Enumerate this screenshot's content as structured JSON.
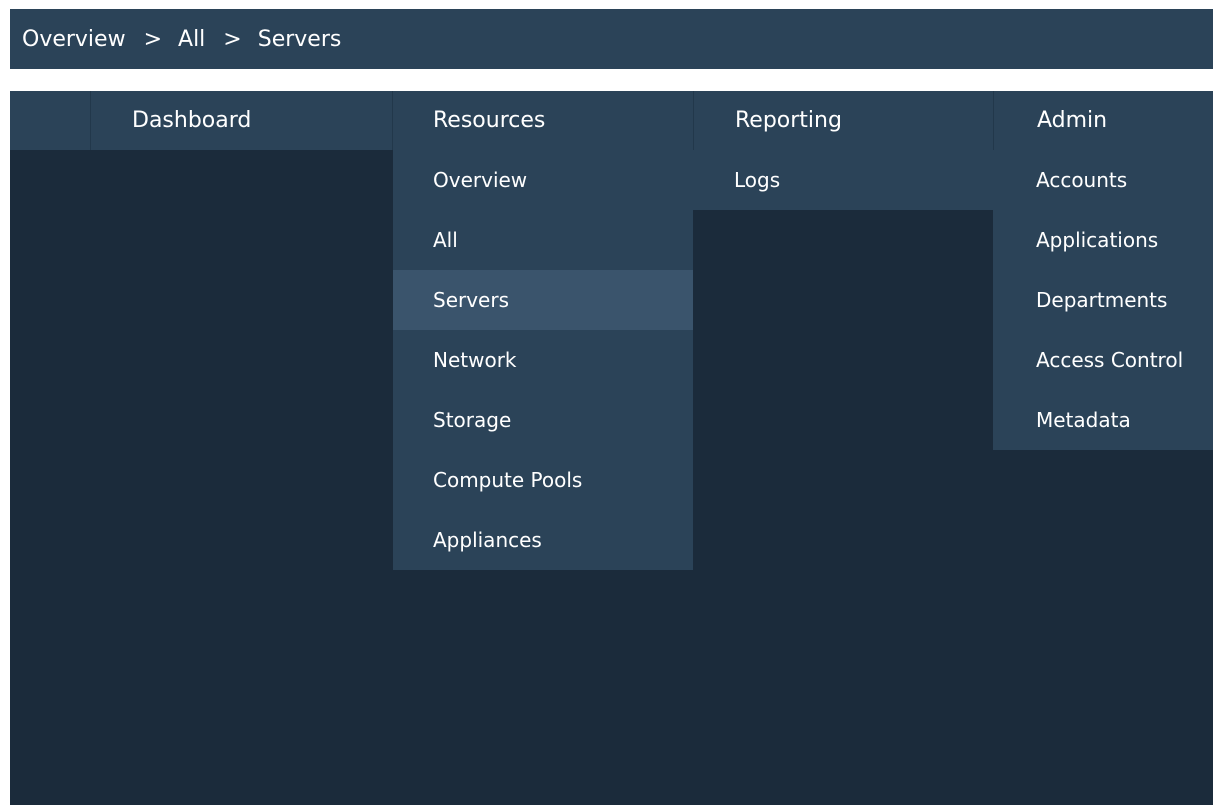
{
  "breadcrumb": {
    "items": [
      "Overview",
      "All",
      "Servers"
    ],
    "separator": ">"
  },
  "menu": {
    "dashboard": {
      "label": "Dashboard"
    },
    "resources": {
      "label": "Resources",
      "items": [
        "Overview",
        "All",
        "Servers",
        "Network",
        "Storage",
        "Compute Pools",
        "Appliances"
      ],
      "active_item": "Servers"
    },
    "reporting": {
      "label": "Reporting",
      "items": [
        "Logs"
      ]
    },
    "admin": {
      "label": "Admin",
      "items": [
        "Accounts",
        "Applications",
        "Departments",
        "Access Control",
        "Metadata"
      ]
    }
  },
  "colors": {
    "bar_background": "#2b4358",
    "main_background": "#1b2b3b",
    "active_item_background": "#3a546c",
    "text": "#ffffff"
  }
}
